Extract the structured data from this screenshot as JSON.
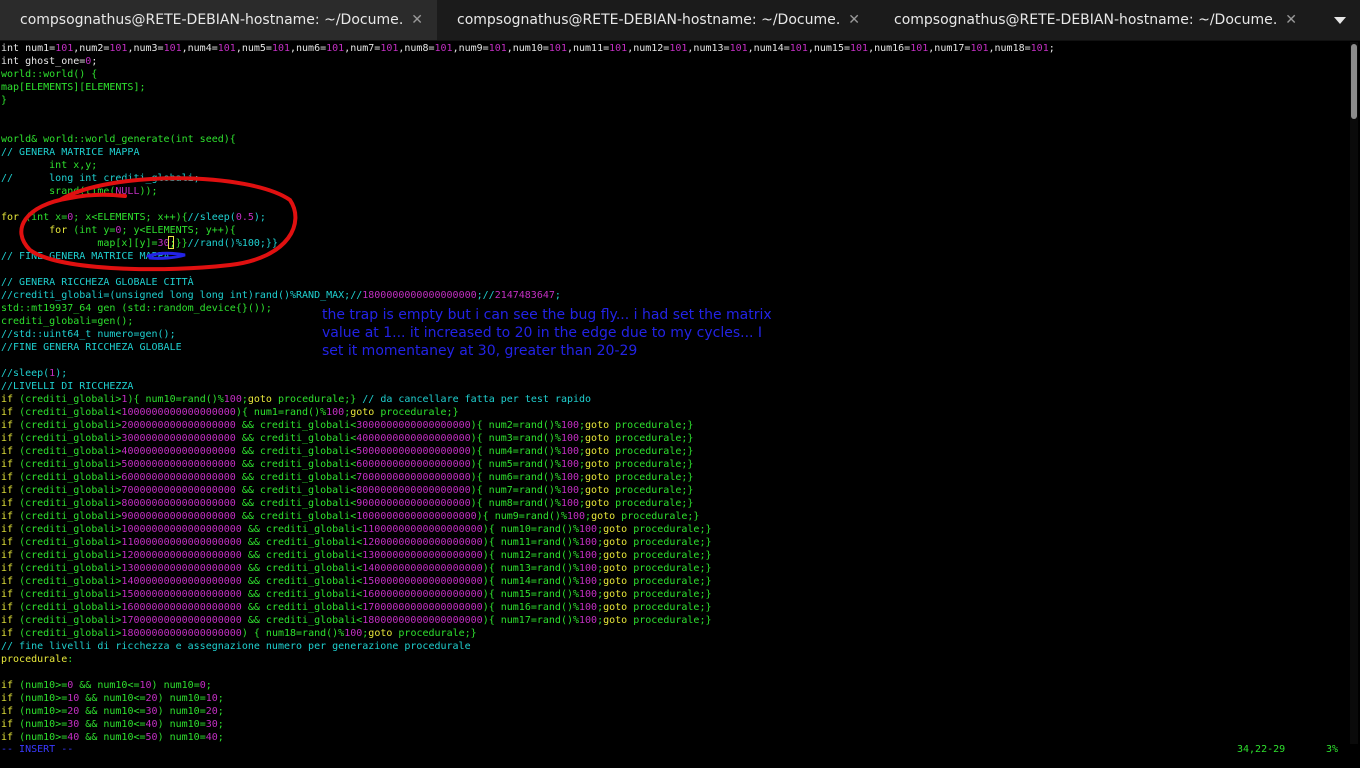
{
  "tabs": [
    {
      "label": "compsognathus@RETE-DEBIAN-hostname: ~/Docume…",
      "active": true
    },
    {
      "label": "compsognathus@RETE-DEBIAN-hostname: ~/Docume…",
      "active": false
    },
    {
      "label": "compsognathus@RETE-DEBIAN-hostname: ~/Docume…",
      "active": false
    }
  ],
  "tab_close_glyph": "✕",
  "annotation": "the trap is empty but i can see the bug fly... i had set the matrix value at 1... it increased to 20 in the edge due to my cycles... I set it momentaney at 30, greater than 20-29",
  "status": {
    "mode": "-- INSERT --",
    "position": "34,22-29",
    "percent": "3%"
  },
  "colors": {
    "comment": "#1fd0d0",
    "type": "#2ee02e",
    "number": "#c32fc3",
    "keyword": "#e7e73a",
    "annotation": "#2323e6",
    "circle": "#e01010"
  },
  "lines": [
    [
      [
        0,
        "int num1="
      ],
      [
        2,
        "101"
      ],
      [
        0,
        ",num2="
      ],
      [
        2,
        "101"
      ],
      [
        0,
        ",num3="
      ],
      [
        2,
        "101"
      ],
      [
        0,
        ",num4="
      ],
      [
        2,
        "101"
      ],
      [
        0,
        ",num5="
      ],
      [
        2,
        "101"
      ],
      [
        0,
        ",num6="
      ],
      [
        2,
        "101"
      ],
      [
        0,
        ",num7="
      ],
      [
        2,
        "101"
      ],
      [
        0,
        ",num8="
      ],
      [
        2,
        "101"
      ],
      [
        0,
        ",num9="
      ],
      [
        2,
        "101"
      ],
      [
        0,
        ",num10="
      ],
      [
        2,
        "101"
      ],
      [
        0,
        ",num11="
      ],
      [
        2,
        "101"
      ],
      [
        0,
        ",num12="
      ],
      [
        2,
        "101"
      ],
      [
        0,
        ",num13="
      ],
      [
        2,
        "101"
      ],
      [
        0,
        ",num14="
      ],
      [
        2,
        "101"
      ],
      [
        0,
        ",num15="
      ],
      [
        2,
        "101"
      ],
      [
        0,
        ",num16="
      ],
      [
        2,
        "101"
      ],
      [
        0,
        ",num17="
      ],
      [
        2,
        "101"
      ],
      [
        0,
        ",num18="
      ],
      [
        2,
        "101"
      ],
      [
        0,
        ";"
      ]
    ],
    [
      [
        0,
        "int ghost_one="
      ],
      [
        2,
        "0"
      ],
      [
        0,
        ";"
      ]
    ],
    [
      [
        1,
        "world::world() {"
      ]
    ],
    [
      [
        1,
        "map[ELEMENTS][ELEMENTS];"
      ]
    ],
    [
      [
        1,
        "}"
      ]
    ],
    [],
    [],
    [
      [
        1,
        "world& world::world_generate(int seed){"
      ]
    ],
    [
      [
        3,
        "// GENERA MATRICE MAPPA"
      ]
    ],
    [
      [
        1,
        "        int x,y;"
      ]
    ],
    [
      [
        3,
        "//      long int crediti_globali;"
      ]
    ],
    [
      [
        1,
        "        srand(time("
      ],
      [
        2,
        "NULL"
      ],
      [
        1,
        "));"
      ]
    ],
    [],
    [
      [
        4,
        "for"
      ],
      [
        1,
        " (int x="
      ],
      [
        2,
        "0"
      ],
      [
        1,
        "; x<ELEMENTS; x++){"
      ],
      [
        3,
        "//sleep("
      ],
      [
        2,
        "0.5"
      ],
      [
        3,
        ");"
      ]
    ],
    [
      [
        4,
        "        for"
      ],
      [
        1,
        " (int y="
      ],
      [
        2,
        "0"
      ],
      [
        1,
        "; y<ELEMENTS; y++){"
      ]
    ],
    [
      [
        1,
        "                map[x][y]="
      ],
      [
        2,
        "30"
      ],
      [
        1,
        ";}}"
      ],
      [
        3,
        "//rand()%100;}}"
      ]
    ],
    [
      [
        3,
        "// FINE GENERA MATRICE MAPPA"
      ]
    ],
    [],
    [
      [
        3,
        "// GENERA RICCHEZA GLOBALE CITTÀ"
      ]
    ],
    [
      [
        3,
        "//crediti_globali=(unsigned long long int)rand()%RAND_MAX;//"
      ],
      [
        2,
        "1800000000000000000"
      ],
      [
        3,
        ";//"
      ],
      [
        2,
        "2147483647"
      ],
      [
        3,
        ";"
      ]
    ],
    [
      [
        1,
        "std::mt19937_64 gen (std::random_device{}());"
      ]
    ],
    [
      [
        1,
        "crediti_globali=gen();"
      ]
    ],
    [
      [
        3,
        "//std::uint64_t numero=gen();"
      ]
    ],
    [
      [
        3,
        "//FINE GENERA RICCHEZA GLOBALE"
      ]
    ],
    [],
    [
      [
        3,
        "//sleep("
      ],
      [
        2,
        "1"
      ],
      [
        3,
        ");"
      ]
    ],
    [
      [
        3,
        "//LIVELLI DI RICCHEZZA"
      ]
    ],
    [
      [
        4,
        "if"
      ],
      [
        1,
        " (crediti_globali>"
      ],
      [
        2,
        "1"
      ],
      [
        1,
        "){ num10=rand()%"
      ],
      [
        2,
        "100"
      ],
      [
        1,
        ";"
      ],
      [
        4,
        "goto"
      ],
      [
        1,
        " procedurale;} "
      ],
      [
        3,
        "// da cancellare fatta per test rapido"
      ]
    ],
    [
      [
        4,
        "if"
      ],
      [
        1,
        " (crediti_globali<"
      ],
      [
        2,
        "1000000000000000000"
      ],
      [
        1,
        "){ num1=rand()%"
      ],
      [
        2,
        "100"
      ],
      [
        1,
        ";"
      ],
      [
        4,
        "goto"
      ],
      [
        1,
        " procedurale;}"
      ]
    ],
    [
      [
        4,
        "if"
      ],
      [
        1,
        " (crediti_globali>"
      ],
      [
        2,
        "2000000000000000000"
      ],
      [
        1,
        " && crediti_globali<"
      ],
      [
        2,
        "3000000000000000000"
      ],
      [
        1,
        "){ num2=rand()%"
      ],
      [
        2,
        "100"
      ],
      [
        1,
        ";"
      ],
      [
        4,
        "goto"
      ],
      [
        1,
        " procedurale;}"
      ]
    ],
    [
      [
        4,
        "if"
      ],
      [
        1,
        " (crediti_globali>"
      ],
      [
        2,
        "3000000000000000000"
      ],
      [
        1,
        " && crediti_globali<"
      ],
      [
        2,
        "4000000000000000000"
      ],
      [
        1,
        "){ num3=rand()%"
      ],
      [
        2,
        "100"
      ],
      [
        1,
        ";"
      ],
      [
        4,
        "goto"
      ],
      [
        1,
        " procedurale;}"
      ]
    ],
    [
      [
        4,
        "if"
      ],
      [
        1,
        " (crediti_globali>"
      ],
      [
        2,
        "4000000000000000000"
      ],
      [
        1,
        " && crediti_globali<"
      ],
      [
        2,
        "5000000000000000000"
      ],
      [
        1,
        "){ num4=rand()%"
      ],
      [
        2,
        "100"
      ],
      [
        1,
        ";"
      ],
      [
        4,
        "goto"
      ],
      [
        1,
        " procedurale;}"
      ]
    ],
    [
      [
        4,
        "if"
      ],
      [
        1,
        " (crediti_globali>"
      ],
      [
        2,
        "5000000000000000000"
      ],
      [
        1,
        " && crediti_globali<"
      ],
      [
        2,
        "6000000000000000000"
      ],
      [
        1,
        "){ num5=rand()%"
      ],
      [
        2,
        "100"
      ],
      [
        1,
        ";"
      ],
      [
        4,
        "goto"
      ],
      [
        1,
        " procedurale;}"
      ]
    ],
    [
      [
        4,
        "if"
      ],
      [
        1,
        " (crediti_globali>"
      ],
      [
        2,
        "6000000000000000000"
      ],
      [
        1,
        " && crediti_globali<"
      ],
      [
        2,
        "7000000000000000000"
      ],
      [
        1,
        "){ num6=rand()%"
      ],
      [
        2,
        "100"
      ],
      [
        1,
        ";"
      ],
      [
        4,
        "goto"
      ],
      [
        1,
        " procedurale;}"
      ]
    ],
    [
      [
        4,
        "if"
      ],
      [
        1,
        " (crediti_globali>"
      ],
      [
        2,
        "7000000000000000000"
      ],
      [
        1,
        " && crediti_globali<"
      ],
      [
        2,
        "8000000000000000000"
      ],
      [
        1,
        "){ num7=rand()%"
      ],
      [
        2,
        "100"
      ],
      [
        1,
        ";"
      ],
      [
        4,
        "goto"
      ],
      [
        1,
        " procedurale;}"
      ]
    ],
    [
      [
        4,
        "if"
      ],
      [
        1,
        " (crediti_globali>"
      ],
      [
        2,
        "8000000000000000000"
      ],
      [
        1,
        " && crediti_globali<"
      ],
      [
        2,
        "9000000000000000000"
      ],
      [
        1,
        "){ num8=rand()%"
      ],
      [
        2,
        "100"
      ],
      [
        1,
        ";"
      ],
      [
        4,
        "goto"
      ],
      [
        1,
        " procedurale;}"
      ]
    ],
    [
      [
        4,
        "if"
      ],
      [
        1,
        " (crediti_globali>"
      ],
      [
        2,
        "9000000000000000000"
      ],
      [
        1,
        " && crediti_globali<"
      ],
      [
        2,
        "10000000000000000000"
      ],
      [
        1,
        "){ num9=rand()%"
      ],
      [
        2,
        "100"
      ],
      [
        1,
        ";"
      ],
      [
        4,
        "goto"
      ],
      [
        1,
        " procedurale;}"
      ]
    ],
    [
      [
        4,
        "if"
      ],
      [
        1,
        " (crediti_globali>"
      ],
      [
        2,
        "10000000000000000000"
      ],
      [
        1,
        " && crediti_globali<"
      ],
      [
        2,
        "11000000000000000000"
      ],
      [
        1,
        "){ num10=rand()%"
      ],
      [
        2,
        "100"
      ],
      [
        1,
        ";"
      ],
      [
        4,
        "goto"
      ],
      [
        1,
        " procedurale;}"
      ]
    ],
    [
      [
        4,
        "if"
      ],
      [
        1,
        " (crediti_globali>"
      ],
      [
        2,
        "11000000000000000000"
      ],
      [
        1,
        " && crediti_globali<"
      ],
      [
        2,
        "12000000000000000000"
      ],
      [
        1,
        "){ num11=rand()%"
      ],
      [
        2,
        "100"
      ],
      [
        1,
        ";"
      ],
      [
        4,
        "goto"
      ],
      [
        1,
        " procedurale;}"
      ]
    ],
    [
      [
        4,
        "if"
      ],
      [
        1,
        " (crediti_globali>"
      ],
      [
        2,
        "12000000000000000000"
      ],
      [
        1,
        " && crediti_globali<"
      ],
      [
        2,
        "13000000000000000000"
      ],
      [
        1,
        "){ num12=rand()%"
      ],
      [
        2,
        "100"
      ],
      [
        1,
        ";"
      ],
      [
        4,
        "goto"
      ],
      [
        1,
        " procedurale;}"
      ]
    ],
    [
      [
        4,
        "if"
      ],
      [
        1,
        " (crediti_globali>"
      ],
      [
        2,
        "13000000000000000000"
      ],
      [
        1,
        " && crediti_globali<"
      ],
      [
        2,
        "14000000000000000000"
      ],
      [
        1,
        "){ num13=rand()%"
      ],
      [
        2,
        "100"
      ],
      [
        1,
        ";"
      ],
      [
        4,
        "goto"
      ],
      [
        1,
        " procedurale;}"
      ]
    ],
    [
      [
        4,
        "if"
      ],
      [
        1,
        " (crediti_globali>"
      ],
      [
        2,
        "14000000000000000000"
      ],
      [
        1,
        " && crediti_globali<"
      ],
      [
        2,
        "15000000000000000000"
      ],
      [
        1,
        "){ num14=rand()%"
      ],
      [
        2,
        "100"
      ],
      [
        1,
        ";"
      ],
      [
        4,
        "goto"
      ],
      [
        1,
        " procedurale;}"
      ]
    ],
    [
      [
        4,
        "if"
      ],
      [
        1,
        " (crediti_globali>"
      ],
      [
        2,
        "15000000000000000000"
      ],
      [
        1,
        " && crediti_globali<"
      ],
      [
        2,
        "16000000000000000000"
      ],
      [
        1,
        "){ num15=rand()%"
      ],
      [
        2,
        "100"
      ],
      [
        1,
        ";"
      ],
      [
        4,
        "goto"
      ],
      [
        1,
        " procedurale;}"
      ]
    ],
    [
      [
        4,
        "if"
      ],
      [
        1,
        " (crediti_globali>"
      ],
      [
        2,
        "16000000000000000000"
      ],
      [
        1,
        " && crediti_globali<"
      ],
      [
        2,
        "17000000000000000000"
      ],
      [
        1,
        "){ num16=rand()%"
      ],
      [
        2,
        "100"
      ],
      [
        1,
        ";"
      ],
      [
        4,
        "goto"
      ],
      [
        1,
        " procedurale;}"
      ]
    ],
    [
      [
        4,
        "if"
      ],
      [
        1,
        " (crediti_globali>"
      ],
      [
        2,
        "17000000000000000000"
      ],
      [
        1,
        " && crediti_globali<"
      ],
      [
        2,
        "18000000000000000000"
      ],
      [
        1,
        "){ num17=rand()%"
      ],
      [
        2,
        "100"
      ],
      [
        1,
        ";"
      ],
      [
        4,
        "goto"
      ],
      [
        1,
        " procedurale;}"
      ]
    ],
    [
      [
        4,
        "if"
      ],
      [
        1,
        " (crediti_globali>"
      ],
      [
        2,
        "18000000000000000000"
      ],
      [
        1,
        ") { num18=rand()%"
      ],
      [
        2,
        "100"
      ],
      [
        1,
        ";"
      ],
      [
        4,
        "goto"
      ],
      [
        1,
        " procedurale;}"
      ]
    ],
    [
      [
        3,
        "// fine livelli di ricchezza e assegnazione numero per generazione procedurale"
      ]
    ],
    [
      [
        4,
        "procedurale"
      ],
      [
        1,
        ":"
      ]
    ],
    [],
    [
      [
        4,
        "if"
      ],
      [
        1,
        " (num10>="
      ],
      [
        2,
        "0"
      ],
      [
        1,
        " && num10<="
      ],
      [
        2,
        "10"
      ],
      [
        1,
        ") num10="
      ],
      [
        2,
        "0"
      ],
      [
        1,
        ";"
      ]
    ],
    [
      [
        4,
        "if"
      ],
      [
        1,
        " (num10>="
      ],
      [
        2,
        "10"
      ],
      [
        1,
        " && num10<="
      ],
      [
        2,
        "20"
      ],
      [
        1,
        ") num10="
      ],
      [
        2,
        "10"
      ],
      [
        1,
        ";"
      ]
    ],
    [
      [
        4,
        "if"
      ],
      [
        1,
        " (num10>="
      ],
      [
        2,
        "20"
      ],
      [
        1,
        " && num10<="
      ],
      [
        2,
        "30"
      ],
      [
        1,
        ") num10="
      ],
      [
        2,
        "20"
      ],
      [
        1,
        ";"
      ]
    ],
    [
      [
        4,
        "if"
      ],
      [
        1,
        " (num10>="
      ],
      [
        2,
        "30"
      ],
      [
        1,
        " && num10<="
      ],
      [
        2,
        "40"
      ],
      [
        1,
        ") num10="
      ],
      [
        2,
        "30"
      ],
      [
        1,
        ";"
      ]
    ],
    [
      [
        4,
        "if"
      ],
      [
        1,
        " (num10>="
      ],
      [
        2,
        "40"
      ],
      [
        1,
        " && num10<="
      ],
      [
        2,
        "50"
      ],
      [
        1,
        ") num10="
      ],
      [
        2,
        "40"
      ],
      [
        1,
        ";"
      ]
    ]
  ]
}
